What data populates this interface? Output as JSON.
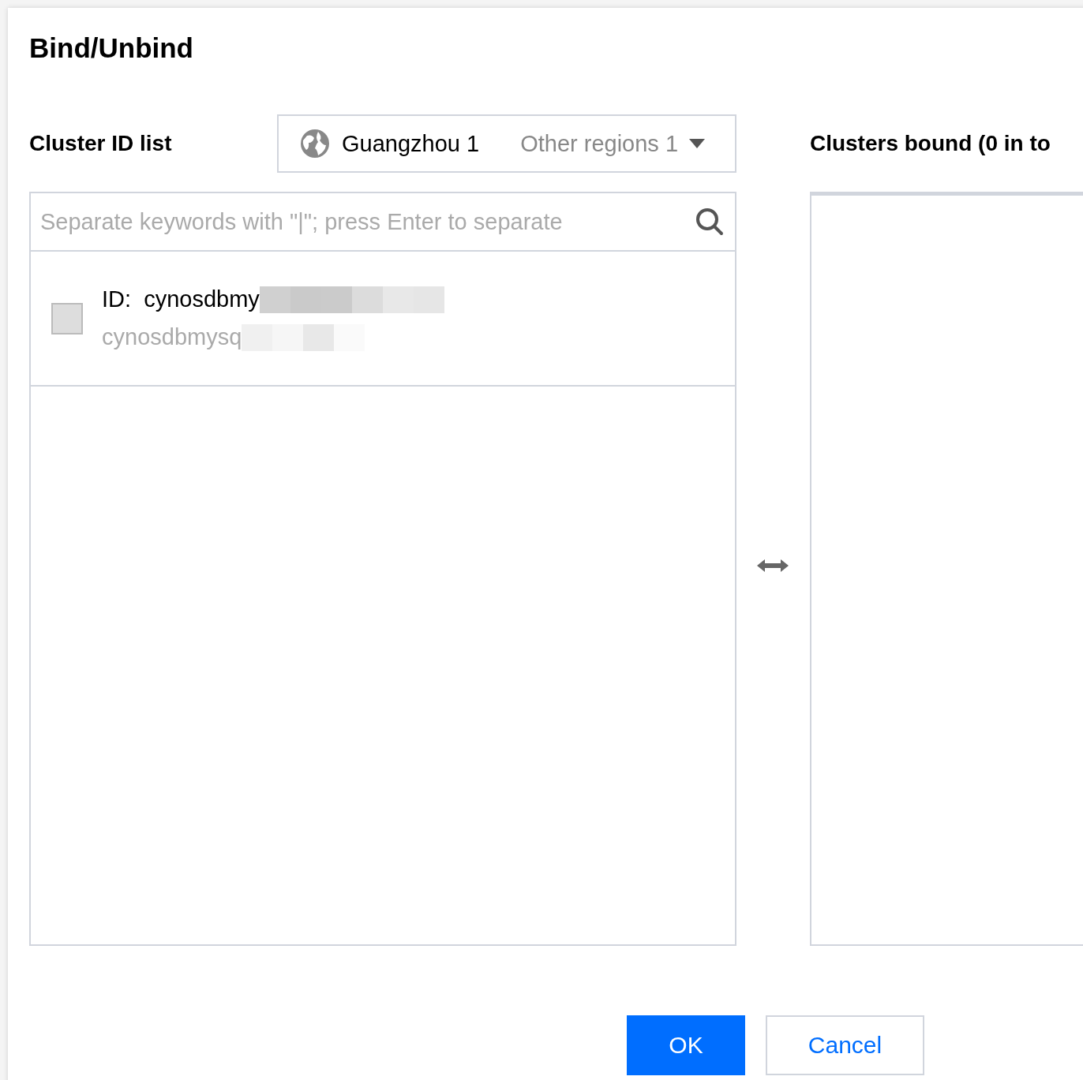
{
  "dialog": {
    "title": "Bind/Unbind"
  },
  "source": {
    "label": "Cluster ID list",
    "regions": [
      {
        "label": "Guangzhou 1",
        "selected": true
      },
      {
        "label": "Other regions 1",
        "selected": false
      }
    ],
    "search": {
      "placeholder": "Separate keywords with \"|\"; press Enter to separate"
    },
    "items": [
      {
        "id_label": "ID:",
        "id": "cynosdbmy",
        "name": "cynosdbmysq",
        "checked": false
      }
    ]
  },
  "target": {
    "label": "Clusters bound (0 in to"
  },
  "buttons": [
    {
      "label": "OK",
      "kind": "primary"
    },
    {
      "label": "Cancel",
      "kind": "secondary"
    }
  ]
}
